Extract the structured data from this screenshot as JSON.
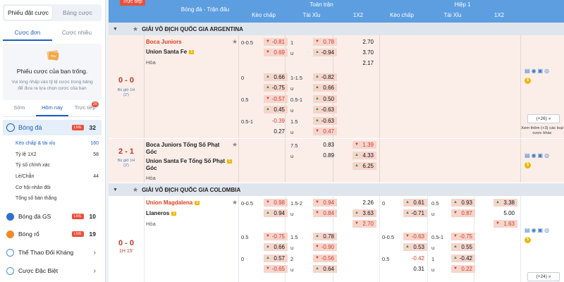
{
  "sidebar": {
    "slip_tabs": [
      "Phiếu đặt cược",
      "Bảng cược"
    ],
    "sub_tabs": [
      "Cược đơn",
      "Cược nhiều"
    ],
    "empty_title": "Phiếu cược của bạn trống.",
    "empty_desc": "Vui lòng nhấp vào tỷ lệ cược trong bảng để đưa ra lựa chọn cược của bạn",
    "time_tabs": [
      "Sớm",
      "Hôm nay",
      "Trực tiếp"
    ],
    "live_count": "26",
    "main_sport": {
      "label": "Bóng đá",
      "badge": "LIVE",
      "count": "32"
    },
    "subitems": [
      {
        "label": "Kèo chấp & tài xỉu",
        "count": "160"
      },
      {
        "label": "Tỷ lệ 1X2",
        "count": "58"
      },
      {
        "label": "Tỷ số chính xác",
        "count": ""
      },
      {
        "label": "Lẻ/Chẵn",
        "count": "44"
      },
      {
        "label": "Cơ hội nhân đôi",
        "count": ""
      },
      {
        "label": "Tổng số bàn thắng",
        "count": ""
      }
    ],
    "sports": [
      {
        "label": "Bóng đá GS",
        "badge": "LIVE",
        "count": "10",
        "color": "#2f6fd1"
      },
      {
        "label": "Bóng rổ",
        "badge": "LIVE",
        "count": "19",
        "color": "#f08a24"
      },
      {
        "label": "Thể Thao Đối Kháng",
        "badge": "",
        "count": "",
        "color": "#4a90d9"
      },
      {
        "label": "Cược Đặc Biệt",
        "badge": "",
        "count": "",
        "color": "#4a90d9"
      }
    ]
  },
  "header": {
    "live_tag": "Trực tiếp",
    "match_col": "Bóng đá - Trận đấu",
    "full_time": "Toàn trận",
    "half_1": "Hiệp 1",
    "cols": [
      "Kèo chấp",
      "Tài Xỉu",
      "1X2",
      "Kèo chấp",
      "Tài Xỉu",
      "1X2"
    ]
  },
  "leagues": [
    "GIẢI VÔ ĐỊCH QUỐC GIA ARGENTINA",
    "GIẢI VÔ ĐỊCH QUỐC GIA COLOMBIA"
  ],
  "match1": {
    "score": "0 - 0",
    "period": "Bù giờ 1H",
    "extra": "(2')",
    "home": "Boca Juniors",
    "away": "Union Santa Fe",
    "away_badge": "1",
    "draw": "Hòa",
    "rows": [
      {
        "hcp": "0-0.5",
        "h1": "-0.81",
        "h2": "0.69",
        "ou": "1",
        "ou2": "u",
        "o1": "0.78",
        "o2": "-0.94",
        "x": [
          "2.70",
          "3.70",
          "2.17"
        ]
      },
      {
        "hcp": "0",
        "h1": "0.66",
        "h2": "-0.75",
        "ou": "1-1.5",
        "ou2": "u",
        "o1": "-0.82",
        "o2": "0.66"
      },
      {
        "hcp": "0.5",
        "h1": "-0.57",
        "h2": "0.45",
        "ou": "0.5-1",
        "ou2": "u",
        "o1": "0.50",
        "o2": "-0.63"
      },
      {
        "hcp": "0.5-1",
        "h1": "-0.39",
        "h2": "0.27",
        "ou": "1.5",
        "ou2": "u",
        "o1": "-0.63",
        "o2": "0.47"
      }
    ],
    "more": "(+26)",
    "more_note": "Xem thêm (+3) các loại cược khác"
  },
  "match2": {
    "score": "2 - 1",
    "period": "Bù giờ 1H",
    "extra": "(2')",
    "home": "Boca Juniors Tổng Số Phạt Góc",
    "away": "Union Santa Fe Tổng Số Phạt Góc",
    "away_badge": "1",
    "draw": "Hòa",
    "ou": "7.5",
    "ou2": "u",
    "o1": "0.83",
    "o2": "0.89",
    "x": [
      "1.39",
      "4.33",
      "6.25"
    ]
  },
  "match3": {
    "score": "0 - 0",
    "clock": "1H 15'",
    "home": "Union Magdalena",
    "home_badge": "1",
    "away": "Llaneros",
    "away_badge": "1",
    "draw": "Hòa",
    "rows": [
      {
        "hcp": "0-0.5",
        "h1": "0.98",
        "h2": "0.94",
        "ou": "1.5-2",
        "ou2": "u",
        "o1": "0.94",
        "o2": "0.84",
        "x": [
          "2.26",
          "3.63",
          "2.70"
        ],
        "hhcp": "0",
        "hh1": "0.61",
        "hh2": "-0.71",
        "hou": "0.5",
        "hou2": "u",
        "ho1": "0.93",
        "ho2": "0.87",
        "hx": [
          "3.38",
          "5.00",
          "1.63"
        ]
      },
      {
        "hcp": "0.5",
        "h1": "-0.75",
        "h2": "0.66",
        "ou": "1.5",
        "ou2": "u",
        "o1": "0.78",
        "o2": "-0.90",
        "hhcp": "0-0.5",
        "hh1": "-0.63",
        "hh2": "0.53",
        "hou": "0.5-1",
        "hou2": "u",
        "ho1": "-0.75",
        "ho2": "0.55"
      },
      {
        "hcp": "0",
        "h1": "0.57",
        "h2": "-0.65",
        "ou": "2",
        "ou2": "u",
        "o1": "-0.56",
        "o2": "0.64",
        "hhcp": "0.5",
        "hh1": "-0.42",
        "hh2": "0.31",
        "hou": "1",
        "hou2": "u",
        "ho1": "-0.42",
        "ho2": "0.22"
      }
    ],
    "more": "(+24)"
  }
}
